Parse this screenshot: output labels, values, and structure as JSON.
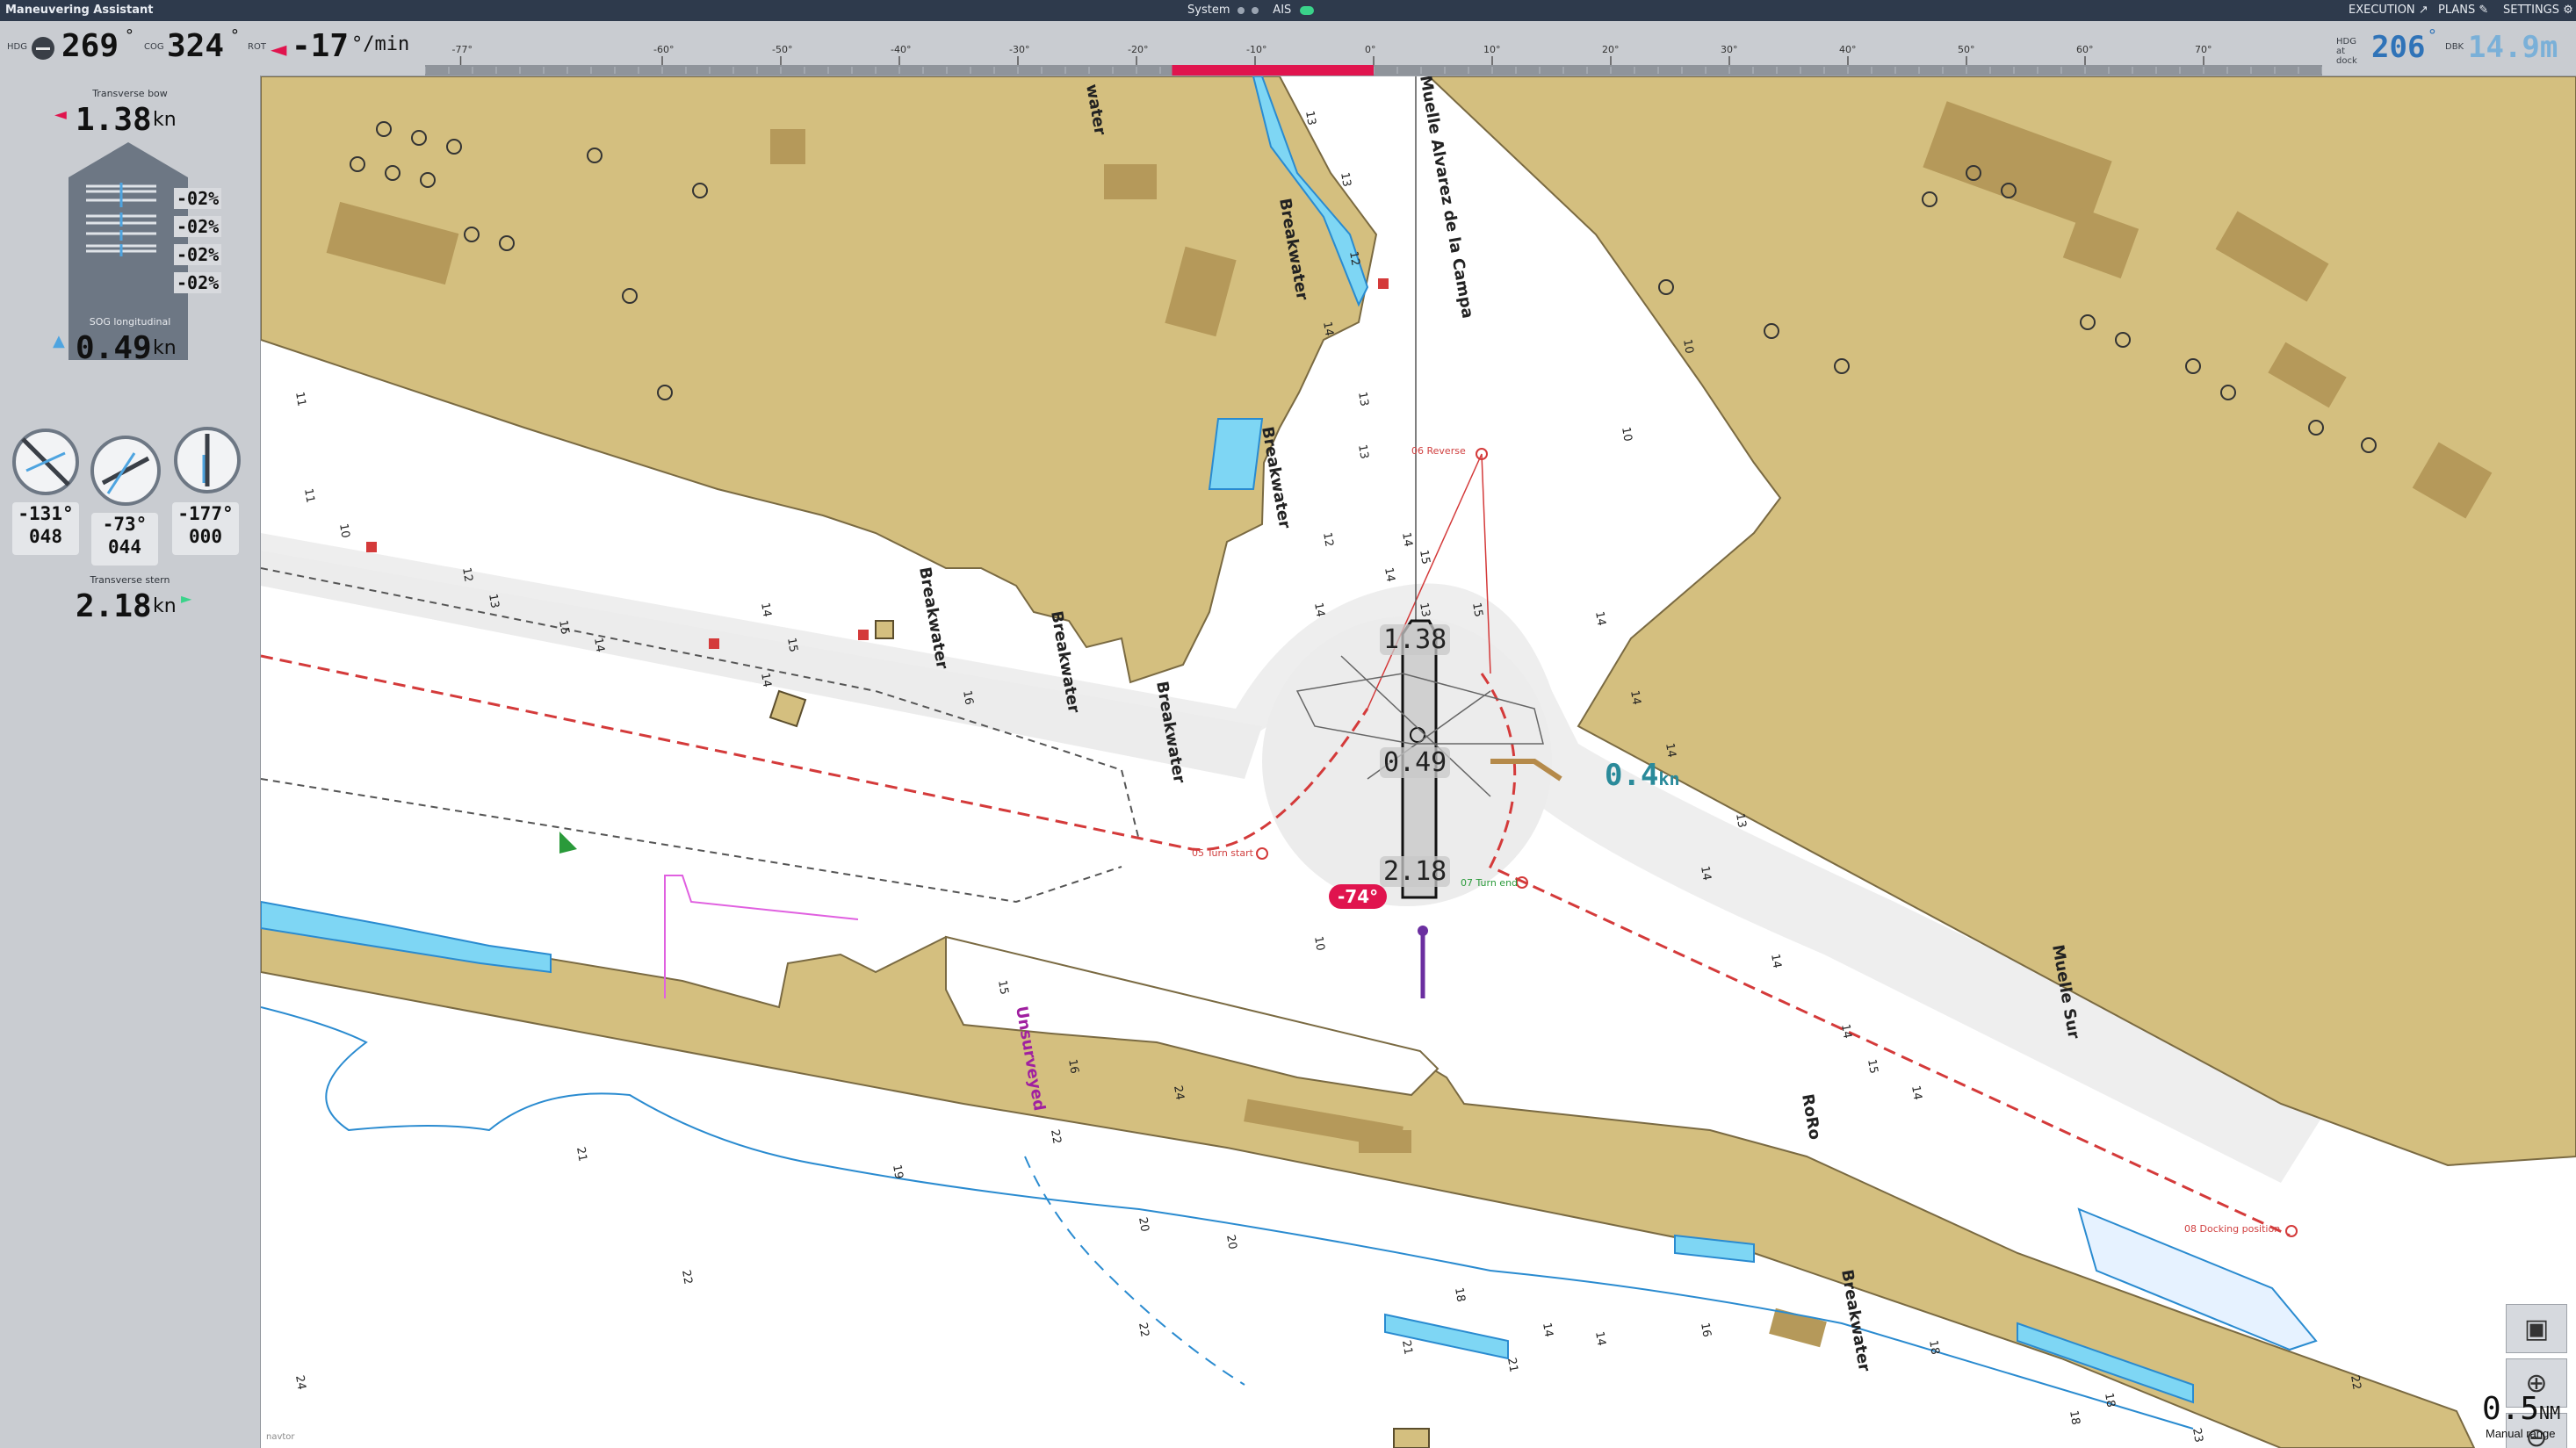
{
  "app": {
    "title": "Maneuvering Assistant",
    "status": {
      "system_label": "System",
      "ais_label": "AIS"
    },
    "menu": {
      "execution": "EXECUTION",
      "plans": "PLANS",
      "settings": "SETTINGS"
    }
  },
  "instruments": {
    "hdg_label": "HDG",
    "hdg_value": "269",
    "cog_label": "COG",
    "cog_value": "324",
    "rot_label": "ROT",
    "rot_value": "-17",
    "rot_unit": "°/min",
    "deg_symbol": "°",
    "rot_scale_ticks": [
      "-77°",
      "-60°",
      "-50°",
      "-40°",
      "-30°",
      "-20°",
      "-10°",
      "0°",
      "10°",
      "20°",
      "30°",
      "40°",
      "50°",
      "60°",
      "70°"
    ],
    "rot_bar_from": -17,
    "rot_bar_to": 0,
    "hdg_at_dock_label": "HDG at dock",
    "hdg_at_dock_value": "206",
    "dbk_label": "DBK",
    "dbk_value": "14.9m"
  },
  "left_panel": {
    "transverse_bow_label": "Transverse bow",
    "transverse_bow_value": "1.38",
    "sog_label": "SOG longitudinal",
    "sog_value": "0.49",
    "transverse_stern_label": "Transverse stern",
    "transverse_stern_value": "2.18",
    "speed_unit": "kn",
    "thruster_percents": [
      "-02%",
      "-02%",
      "-02%",
      "-02%"
    ],
    "azimuth_gauges": [
      {
        "angle": "-131°",
        "power": "048"
      },
      {
        "angle": "-73°",
        "power": "044"
      },
      {
        "angle": "-177°",
        "power": "000"
      }
    ]
  },
  "map": {
    "labels": {
      "breakwater": "Breakwater",
      "muelle_alvarez": "Muelle Alvarez de la Campa",
      "muelle_sur": "Muelle Sur",
      "unsurveyed": "Unsurveyed",
      "water": "water",
      "roro": "RoRo"
    },
    "waypoints": {
      "reverse": "06 Reverse",
      "turn_start": "05 Turn start",
      "turn_end": "07 Turn end",
      "docking": "08 Docking position"
    },
    "overlay": {
      "bow_speed": "1.38",
      "sog_speed": "0.49",
      "stern_speed": "2.18",
      "rudder": "-74°",
      "current_speed": "0.4",
      "current_unit": "kn"
    },
    "depths": [
      "13",
      "13",
      "12",
      "14",
      "13",
      "13",
      "14",
      "12",
      "13",
      "14",
      "10",
      "10",
      "11",
      "11",
      "10",
      "12",
      "13",
      "15",
      "14",
      "14",
      "14",
      "15",
      "16",
      "14",
      "14",
      "15",
      "15",
      "14",
      "14",
      "14",
      "13",
      "14",
      "14",
      "15",
      "14",
      "21",
      "22",
      "22",
      "20",
      "20",
      "22",
      "19",
      "21",
      "18",
      "21",
      "14",
      "14",
      "16",
      "18",
      "18",
      "18",
      "23",
      "22",
      "24",
      "15",
      "16",
      "24",
      "10"
    ],
    "range_value": "0.5",
    "range_unit": "NM",
    "range_note": "Manual range",
    "logo": "navtor"
  },
  "colors": {
    "land": "#d4bf7f",
    "building": "#b5995a",
    "shallow": "#7ed6f4",
    "route": "#d43a3a",
    "turn_area": "#ececec",
    "panel": "#c9ccd1",
    "rot_bar": "#e0144e",
    "dbk": "#7ab0d8"
  }
}
